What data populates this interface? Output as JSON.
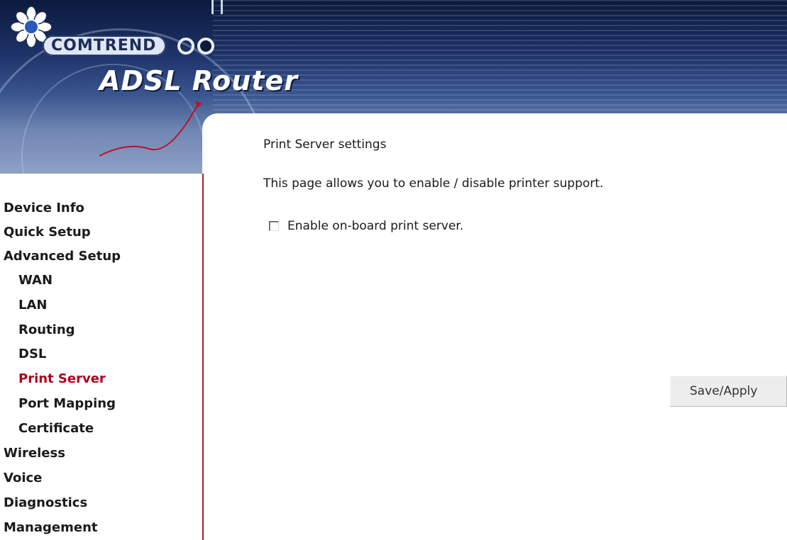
{
  "header": {
    "brand": "COMTREND",
    "product": "ADSL Router"
  },
  "sidebar": {
    "items": [
      {
        "label": "Device Info",
        "level": "top",
        "active": false
      },
      {
        "label": "Quick Setup",
        "level": "top",
        "active": false
      },
      {
        "label": "Advanced Setup",
        "level": "top",
        "active": false
      },
      {
        "label": "WAN",
        "level": "sub",
        "active": false
      },
      {
        "label": "LAN",
        "level": "sub",
        "active": false
      },
      {
        "label": "Routing",
        "level": "sub",
        "active": false
      },
      {
        "label": "DSL",
        "level": "sub",
        "active": false
      },
      {
        "label": "Print Server",
        "level": "sub",
        "active": true
      },
      {
        "label": "Port Mapping",
        "level": "sub",
        "active": false
      },
      {
        "label": "Certificate",
        "level": "sub",
        "active": false
      },
      {
        "label": "Wireless",
        "level": "top",
        "active": false
      },
      {
        "label": "Voice",
        "level": "top",
        "active": false
      },
      {
        "label": "Diagnostics",
        "level": "top",
        "active": false
      },
      {
        "label": "Management",
        "level": "top",
        "active": false
      }
    ]
  },
  "main": {
    "title": "Print Server settings",
    "description": "This page allows you to enable / disable printer support.",
    "enable_checkbox": {
      "label": "Enable on-board print server.",
      "checked": false
    },
    "save_button": "Save/Apply"
  },
  "colors": {
    "active_nav": "#b0001e",
    "sidebar_border": "#9b2335",
    "banner_dark": "#0c1a3d"
  }
}
